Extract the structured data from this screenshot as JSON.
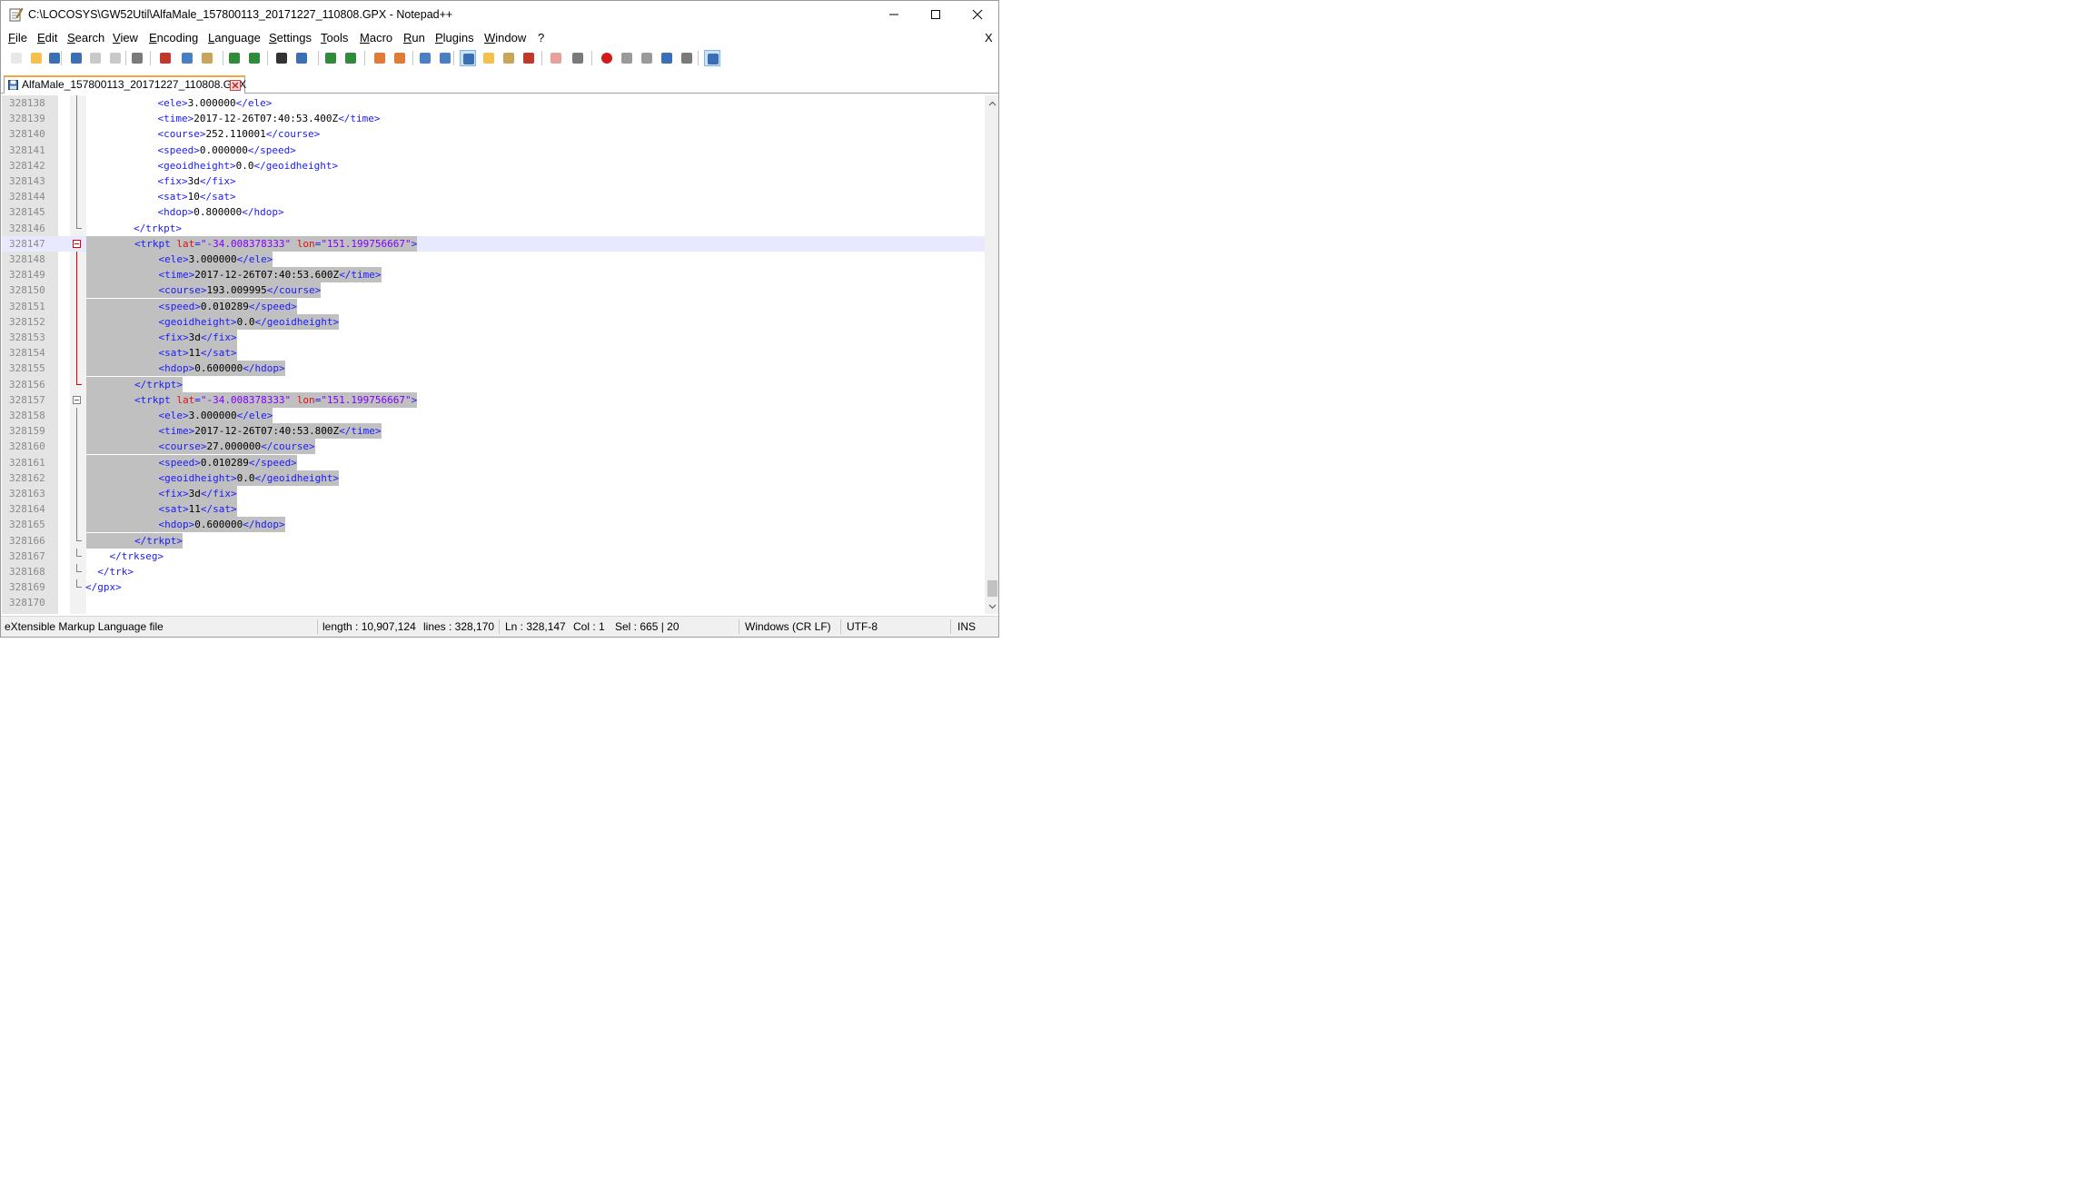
{
  "window": {
    "title": "C:\\LOCOSYS\\GW52Util\\AlfaMale_157800113_20171227_110808.GPX - Notepad++",
    "menu_close_label": "X"
  },
  "menu": [
    "File",
    "Edit",
    "Search",
    "View",
    "Encoding",
    "Language",
    "Settings",
    "Tools",
    "Macro",
    "Run",
    "Plugins",
    "Window",
    "?"
  ],
  "toolbar": [
    {
      "name": "new-file-icon",
      "color": "#e8e8e8"
    },
    {
      "name": "open-file-icon",
      "color": "#f2c14e"
    },
    {
      "name": "save-icon",
      "color": "#3a6fb5"
    },
    {
      "name": "save-all-icon",
      "color": "#3a6fb5"
    },
    {
      "name": "close-icon",
      "color": "#c9c9c9"
    },
    {
      "name": "close-all-icon",
      "color": "#c9c9c9"
    },
    {
      "name": "print-icon",
      "color": "#7a7a7a"
    },
    {
      "name": "cut-icon",
      "color": "#c0392b"
    },
    {
      "name": "copy-icon",
      "color": "#4a7fc1"
    },
    {
      "name": "paste-icon",
      "color": "#c9a45c"
    },
    {
      "name": "undo-icon",
      "color": "#2e8b3a"
    },
    {
      "name": "redo-icon",
      "color": "#2e8b3a"
    },
    {
      "name": "find-icon",
      "color": "#333333"
    },
    {
      "name": "replace-icon",
      "color": "#3a6fb5"
    },
    {
      "name": "zoom-in-icon",
      "color": "#2e8b3a"
    },
    {
      "name": "zoom-out-icon",
      "color": "#2e8b3a"
    },
    {
      "name": "sync-vertical-icon",
      "color": "#e07b39"
    },
    {
      "name": "sync-horizontal-icon",
      "color": "#e07b39"
    },
    {
      "name": "word-wrap-icon",
      "color": "#4a7fc1"
    },
    {
      "name": "show-all-chars-icon",
      "color": "#4a7fc1"
    },
    {
      "name": "indent-guide-icon",
      "color": "#3a6fb5"
    },
    {
      "name": "user-lang-icon",
      "color": "#f2c14e"
    },
    {
      "name": "doc-map-icon",
      "color": "#c9a45c"
    },
    {
      "name": "function-list-icon",
      "color": "#c0392b"
    },
    {
      "name": "folder-workspace-icon",
      "color": "#e6a0a0"
    },
    {
      "name": "monitoring-icon",
      "color": "#7a7a7a"
    },
    {
      "name": "record-macro-icon",
      "color": "#d11a1a"
    },
    {
      "name": "stop-macro-icon",
      "color": "#9a9a9a"
    },
    {
      "name": "play-macro-icon",
      "color": "#9a9a9a"
    },
    {
      "name": "run-macro-multiple-icon",
      "color": "#3a6fb5"
    },
    {
      "name": "save-macro-icon",
      "color": "#7a7a7a"
    },
    {
      "name": "spell-check-icon",
      "color": "#3a6fb5"
    }
  ],
  "tab": {
    "label": "AlfaMale_157800113_20171227_110808.GPX"
  },
  "editor": {
    "lines": [
      {
        "num": "328138",
        "parts": [
          [
            "i",
            "            "
          ],
          [
            "t",
            "<ele>"
          ],
          [
            "x",
            "3.000000"
          ],
          [
            "t",
            "</ele>"
          ]
        ]
      },
      {
        "num": "328139",
        "parts": [
          [
            "i",
            "            "
          ],
          [
            "t",
            "<time>"
          ],
          [
            "x",
            "2017-12-26T07:40:53.400Z"
          ],
          [
            "t",
            "</time>"
          ]
        ]
      },
      {
        "num": "328140",
        "parts": [
          [
            "i",
            "            "
          ],
          [
            "t",
            "<course>"
          ],
          [
            "x",
            "252.110001"
          ],
          [
            "t",
            "</course>"
          ]
        ]
      },
      {
        "num": "328141",
        "parts": [
          [
            "i",
            "            "
          ],
          [
            "t",
            "<speed>"
          ],
          [
            "x",
            "0.000000"
          ],
          [
            "t",
            "</speed>"
          ]
        ]
      },
      {
        "num": "328142",
        "parts": [
          [
            "i",
            "            "
          ],
          [
            "t",
            "<geoidheight>"
          ],
          [
            "x",
            "0.0"
          ],
          [
            "t",
            "</geoidheight>"
          ]
        ]
      },
      {
        "num": "328143",
        "parts": [
          [
            "i",
            "            "
          ],
          [
            "t",
            "<fix>"
          ],
          [
            "x",
            "3d"
          ],
          [
            "t",
            "</fix>"
          ]
        ]
      },
      {
        "num": "328144",
        "parts": [
          [
            "i",
            "            "
          ],
          [
            "t",
            "<sat>"
          ],
          [
            "x",
            "10"
          ],
          [
            "t",
            "</sat>"
          ]
        ]
      },
      {
        "num": "328145",
        "parts": [
          [
            "i",
            "            "
          ],
          [
            "t",
            "<hdop>"
          ],
          [
            "x",
            "0.800000"
          ],
          [
            "t",
            "</hdop>"
          ]
        ]
      },
      {
        "num": "328146",
        "parts": [
          [
            "i",
            "        "
          ],
          [
            "t",
            "</trkpt>"
          ]
        ]
      },
      {
        "num": "328147",
        "parts": [
          [
            "i",
            "        "
          ],
          [
            "t",
            "<trkpt "
          ],
          [
            "a",
            "lat"
          ],
          [
            "t",
            "="
          ],
          [
            "v",
            "\"-34.008378333\""
          ],
          [
            "t",
            " "
          ],
          [
            "a",
            "lon"
          ],
          [
            "t",
            "="
          ],
          [
            "v",
            "\"151.199756667\""
          ],
          [
            "t",
            ">"
          ]
        ]
      },
      {
        "num": "328148",
        "parts": [
          [
            "i",
            "            "
          ],
          [
            "t",
            "<ele>"
          ],
          [
            "x",
            "3.000000"
          ],
          [
            "t",
            "</ele>"
          ]
        ]
      },
      {
        "num": "328149",
        "parts": [
          [
            "i",
            "            "
          ],
          [
            "t",
            "<time>"
          ],
          [
            "x",
            "2017-12-26T07:40:53.600Z"
          ],
          [
            "t",
            "</time>"
          ]
        ]
      },
      {
        "num": "328150",
        "parts": [
          [
            "i",
            "            "
          ],
          [
            "t",
            "<course>"
          ],
          [
            "x",
            "193.009995"
          ],
          [
            "t",
            "</course>"
          ]
        ]
      },
      {
        "num": "328151",
        "parts": [
          [
            "i",
            "            "
          ],
          [
            "t",
            "<speed>"
          ],
          [
            "x",
            "0.010289"
          ],
          [
            "t",
            "</speed>"
          ]
        ]
      },
      {
        "num": "328152",
        "parts": [
          [
            "i",
            "            "
          ],
          [
            "t",
            "<geoidheight>"
          ],
          [
            "x",
            "0.0"
          ],
          [
            "t",
            "</geoidheight>"
          ]
        ]
      },
      {
        "num": "328153",
        "parts": [
          [
            "i",
            "            "
          ],
          [
            "t",
            "<fix>"
          ],
          [
            "x",
            "3d"
          ],
          [
            "t",
            "</fix>"
          ]
        ]
      },
      {
        "num": "328154",
        "parts": [
          [
            "i",
            "            "
          ],
          [
            "t",
            "<sat>"
          ],
          [
            "x",
            "11"
          ],
          [
            "t",
            "</sat>"
          ]
        ]
      },
      {
        "num": "328155",
        "parts": [
          [
            "i",
            "            "
          ],
          [
            "t",
            "<hdop>"
          ],
          [
            "x",
            "0.600000"
          ],
          [
            "t",
            "</hdop>"
          ]
        ]
      },
      {
        "num": "328156",
        "parts": [
          [
            "i",
            "        "
          ],
          [
            "t",
            "</trkpt>"
          ]
        ]
      },
      {
        "num": "328157",
        "parts": [
          [
            "i",
            "        "
          ],
          [
            "t",
            "<trkpt "
          ],
          [
            "a",
            "lat"
          ],
          [
            "t",
            "="
          ],
          [
            "v",
            "\"-34.008378333\""
          ],
          [
            "t",
            " "
          ],
          [
            "a",
            "lon"
          ],
          [
            "t",
            "="
          ],
          [
            "v",
            "\"151.199756667\""
          ],
          [
            "t",
            ">"
          ]
        ]
      },
      {
        "num": "328158",
        "parts": [
          [
            "i",
            "            "
          ],
          [
            "t",
            "<ele>"
          ],
          [
            "x",
            "3.000000"
          ],
          [
            "t",
            "</ele>"
          ]
        ]
      },
      {
        "num": "328159",
        "parts": [
          [
            "i",
            "            "
          ],
          [
            "t",
            "<time>"
          ],
          [
            "x",
            "2017-12-26T07:40:53.800Z"
          ],
          [
            "t",
            "</time>"
          ]
        ]
      },
      {
        "num": "328160",
        "parts": [
          [
            "i",
            "            "
          ],
          [
            "t",
            "<course>"
          ],
          [
            "x",
            "27.000000"
          ],
          [
            "t",
            "</course>"
          ]
        ]
      },
      {
        "num": "328161",
        "parts": [
          [
            "i",
            "            "
          ],
          [
            "t",
            "<speed>"
          ],
          [
            "x",
            "0.010289"
          ],
          [
            "t",
            "</speed>"
          ]
        ]
      },
      {
        "num": "328162",
        "parts": [
          [
            "i",
            "            "
          ],
          [
            "t",
            "<geoidheight>"
          ],
          [
            "x",
            "0.0"
          ],
          [
            "t",
            "</geoidheight>"
          ]
        ]
      },
      {
        "num": "328163",
        "parts": [
          [
            "i",
            "            "
          ],
          [
            "t",
            "<fix>"
          ],
          [
            "x",
            "3d"
          ],
          [
            "t",
            "</fix>"
          ]
        ]
      },
      {
        "num": "328164",
        "parts": [
          [
            "i",
            "            "
          ],
          [
            "t",
            "<sat>"
          ],
          [
            "x",
            "11"
          ],
          [
            "t",
            "</sat>"
          ]
        ]
      },
      {
        "num": "328165",
        "parts": [
          [
            "i",
            "            "
          ],
          [
            "t",
            "<hdop>"
          ],
          [
            "x",
            "0.600000"
          ],
          [
            "t",
            "</hdop>"
          ]
        ]
      },
      {
        "num": "328166",
        "parts": [
          [
            "i",
            "        "
          ],
          [
            "t",
            "</trkpt>"
          ]
        ]
      },
      {
        "num": "328167",
        "parts": [
          [
            "i",
            "    "
          ],
          [
            "t",
            "</trkseg>"
          ]
        ]
      },
      {
        "num": "328168",
        "parts": [
          [
            "i",
            "  "
          ],
          [
            "t",
            "</trk>"
          ]
        ]
      },
      {
        "num": "328169",
        "parts": [
          [
            "t",
            "</gpx>"
          ]
        ]
      },
      {
        "num": "328170",
        "parts": []
      }
    ]
  },
  "status": {
    "file_type": "eXtensible Markup Language file",
    "length": "length : 10,907,124",
    "lines": "lines : 328,170",
    "position": "Ln : 328,147",
    "column": "Col : 1",
    "selection": "Sel : 665 | 20",
    "eol": "Windows (CR LF)",
    "encoding": "UTF-8",
    "mode": "INS"
  }
}
